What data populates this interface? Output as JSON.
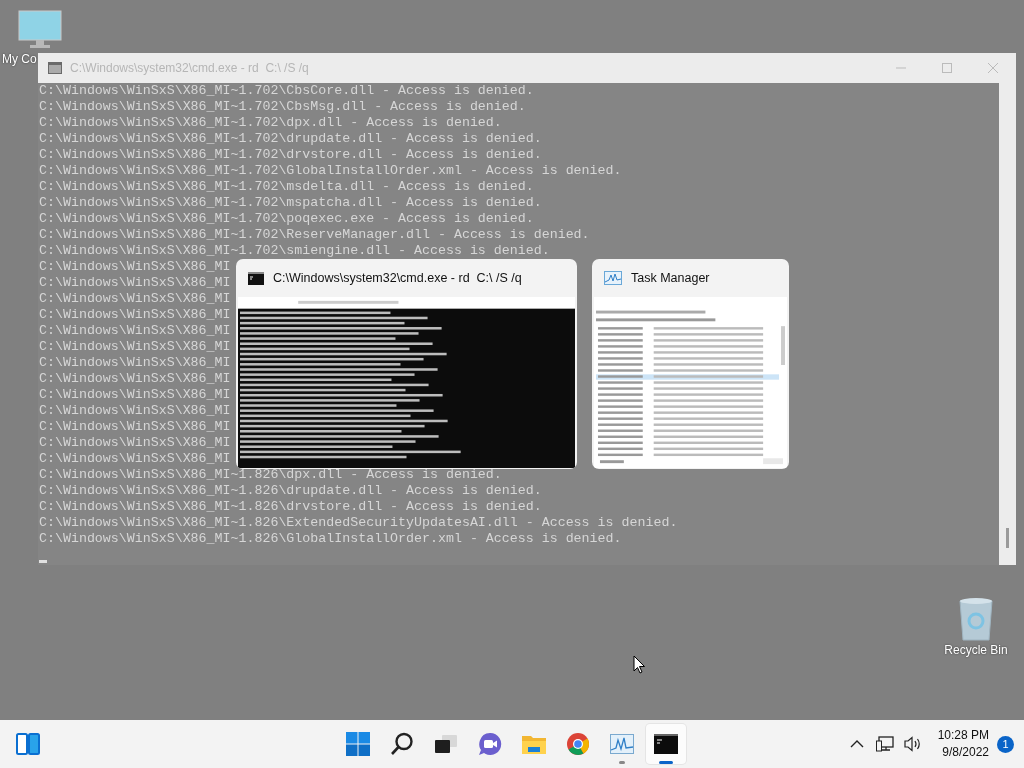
{
  "desktop_icons": [
    {
      "kind": "computer",
      "label": "My Co"
    },
    {
      "kind": "recycle-bin",
      "label": "Recycle Bin"
    }
  ],
  "console_window": {
    "title": "C:\\Windows\\system32\\cmd.exe - rd  C:\\ /S /q",
    "lines": [
      "C:\\Windows\\WinSxS\\X86_MI~1.702\\CbsCore.dll - Access is denied.",
      "C:\\Windows\\WinSxS\\X86_MI~1.702\\CbsMsg.dll - Access is denied.",
      "C:\\Windows\\WinSxS\\X86_MI~1.702\\dpx.dll - Access is denied.",
      "C:\\Windows\\WinSxS\\X86_MI~1.702\\drupdate.dll - Access is denied.",
      "C:\\Windows\\WinSxS\\X86_MI~1.702\\drvstore.dll - Access is denied.",
      "C:\\Windows\\WinSxS\\X86_MI~1.702\\GlobalInstallOrder.xml - Access is denied.",
      "C:\\Windows\\WinSxS\\X86_MI~1.702\\msdelta.dll - Access is denied.",
      "C:\\Windows\\WinSxS\\X86_MI~1.702\\mspatcha.dll - Access is denied.",
      "C:\\Windows\\WinSxS\\X86_MI~1.702\\poqexec.exe - Access is denied.",
      "C:\\Windows\\WinSxS\\X86_MI~1.702\\ReserveManager.dll - Access is denied.",
      "C:\\Windows\\WinSxS\\X86_MI~1.702\\smiengine.dll - Access is denied.",
      "C:\\Windows\\WinSxS\\X86_MI",
      "C:\\Windows\\WinSxS\\X86_MI",
      "C:\\Windows\\WinSxS\\X86_MI",
      "C:\\Windows\\WinSxS\\X86_MI",
      "C:\\Windows\\WinSxS\\X86_MI",
      "C:\\Windows\\WinSxS\\X86_MI",
      "C:\\Windows\\WinSxS\\X86_MI",
      "C:\\Windows\\WinSxS\\X86_MI",
      "C:\\Windows\\WinSxS\\X86_MI",
      "C:\\Windows\\WinSxS\\X86_MI",
      "C:\\Windows\\WinSxS\\X86_MI",
      "C:\\Windows\\WinSxS\\X86_MI",
      "C:\\Windows\\WinSxS\\X86_MI",
      "C:\\Windows\\WinSxS\\X86_MI~1.826\\dpx.dll - Access is denied.",
      "C:\\Windows\\WinSxS\\X86_MI~1.826\\drupdate.dll - Access is denied.",
      "C:\\Windows\\WinSxS\\X86_MI~1.826\\drvstore.dll - Access is denied.",
      "C:\\Windows\\WinSxS\\X86_MI~1.826\\ExtendedSecurityUpdatesAI.dll - Access is denied.",
      "C:\\Windows\\WinSxS\\X86_MI~1.826\\GlobalInstallOrder.xml - Access is denied."
    ]
  },
  "task_switcher": {
    "windows": [
      {
        "kind": "console",
        "title": "C:\\Windows\\system32\\cmd.exe - rd  C:\\ /S /q"
      },
      {
        "kind": "task-manager",
        "title": "Task Manager"
      }
    ]
  },
  "taskbar": {
    "apps": [
      {
        "kind": "start",
        "open": false,
        "active": false
      },
      {
        "kind": "search",
        "open": false,
        "active": false
      },
      {
        "kind": "task-view",
        "open": false,
        "active": false
      },
      {
        "kind": "chat",
        "open": false,
        "active": false
      },
      {
        "kind": "file-explorer",
        "open": false,
        "active": false
      },
      {
        "kind": "browser",
        "open": false,
        "active": false
      },
      {
        "kind": "task-manager",
        "open": true,
        "active": false
      },
      {
        "kind": "console",
        "open": true,
        "active": true
      }
    ],
    "clock": {
      "time": "10:28 PM",
      "date": "9/8/2022"
    },
    "notification_count": "1"
  }
}
